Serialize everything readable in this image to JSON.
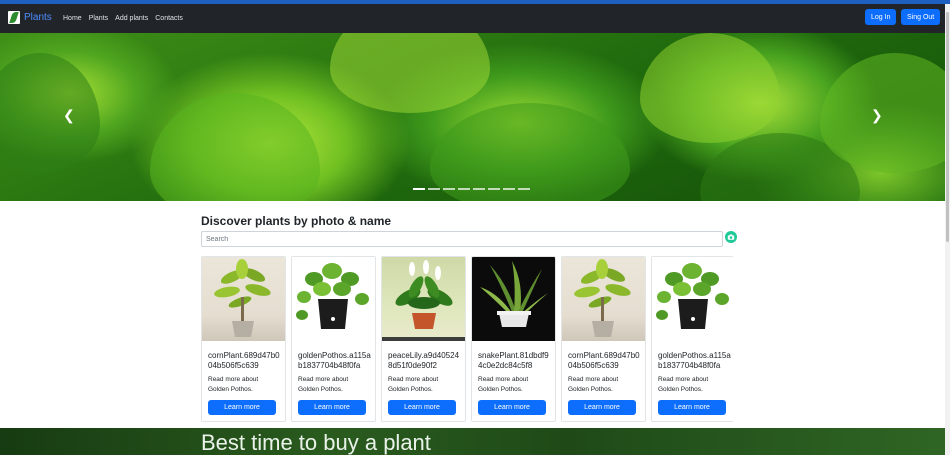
{
  "navbar": {
    "brand": "Plants",
    "links": [
      "Home",
      "Plants",
      "Add plants",
      "Contacts"
    ],
    "login_label": "Log In",
    "signout_label": "Sing Out"
  },
  "carousel": {
    "prev_icon": "chevron-left-icon",
    "next_icon": "chevron-right-icon",
    "slide_count": 8,
    "active_index": 0
  },
  "discover": {
    "title": "Discover plants by photo & name",
    "search_placeholder": "Search",
    "camera_icon": "camera-icon"
  },
  "cards": [
    {
      "title": "cornPlant.689d47b004b506f5c639",
      "text": "Read more about Golden Pothos.",
      "button": "Learn more",
      "image": "corn-plant"
    },
    {
      "title": "goldenPothos.a115ab1837704b48f0fa",
      "text": "Read more about Golden Pothos.",
      "button": "Learn more",
      "image": "golden-pothos"
    },
    {
      "title": "peaceLily.a9d405248d51f0de90f2",
      "text": "Read more about Golden Pothos.",
      "button": "Learn more",
      "image": "peace-lily"
    },
    {
      "title": "snakePlant.81dbdf94c0e2dc84c5f8",
      "text": "Read more about Golden Pothos.",
      "button": "Learn more",
      "image": "snake-plant"
    },
    {
      "title": "cornPlant.689d47b004b506f5c639",
      "text": "Read more about Golden Pothos.",
      "button": "Learn more",
      "image": "corn-plant"
    },
    {
      "title": "goldenPothos.a115ab1837704b48f0fa",
      "text": "Read more about Golden Pothos.",
      "button": "Learn more",
      "image": "golden-pothos"
    }
  ],
  "banner": {
    "title": "Best time to buy a plant"
  },
  "colors": {
    "navbar": "#212529",
    "primary": "#0d6efd",
    "accent": "#20c997",
    "brand": "#4d8dff"
  }
}
